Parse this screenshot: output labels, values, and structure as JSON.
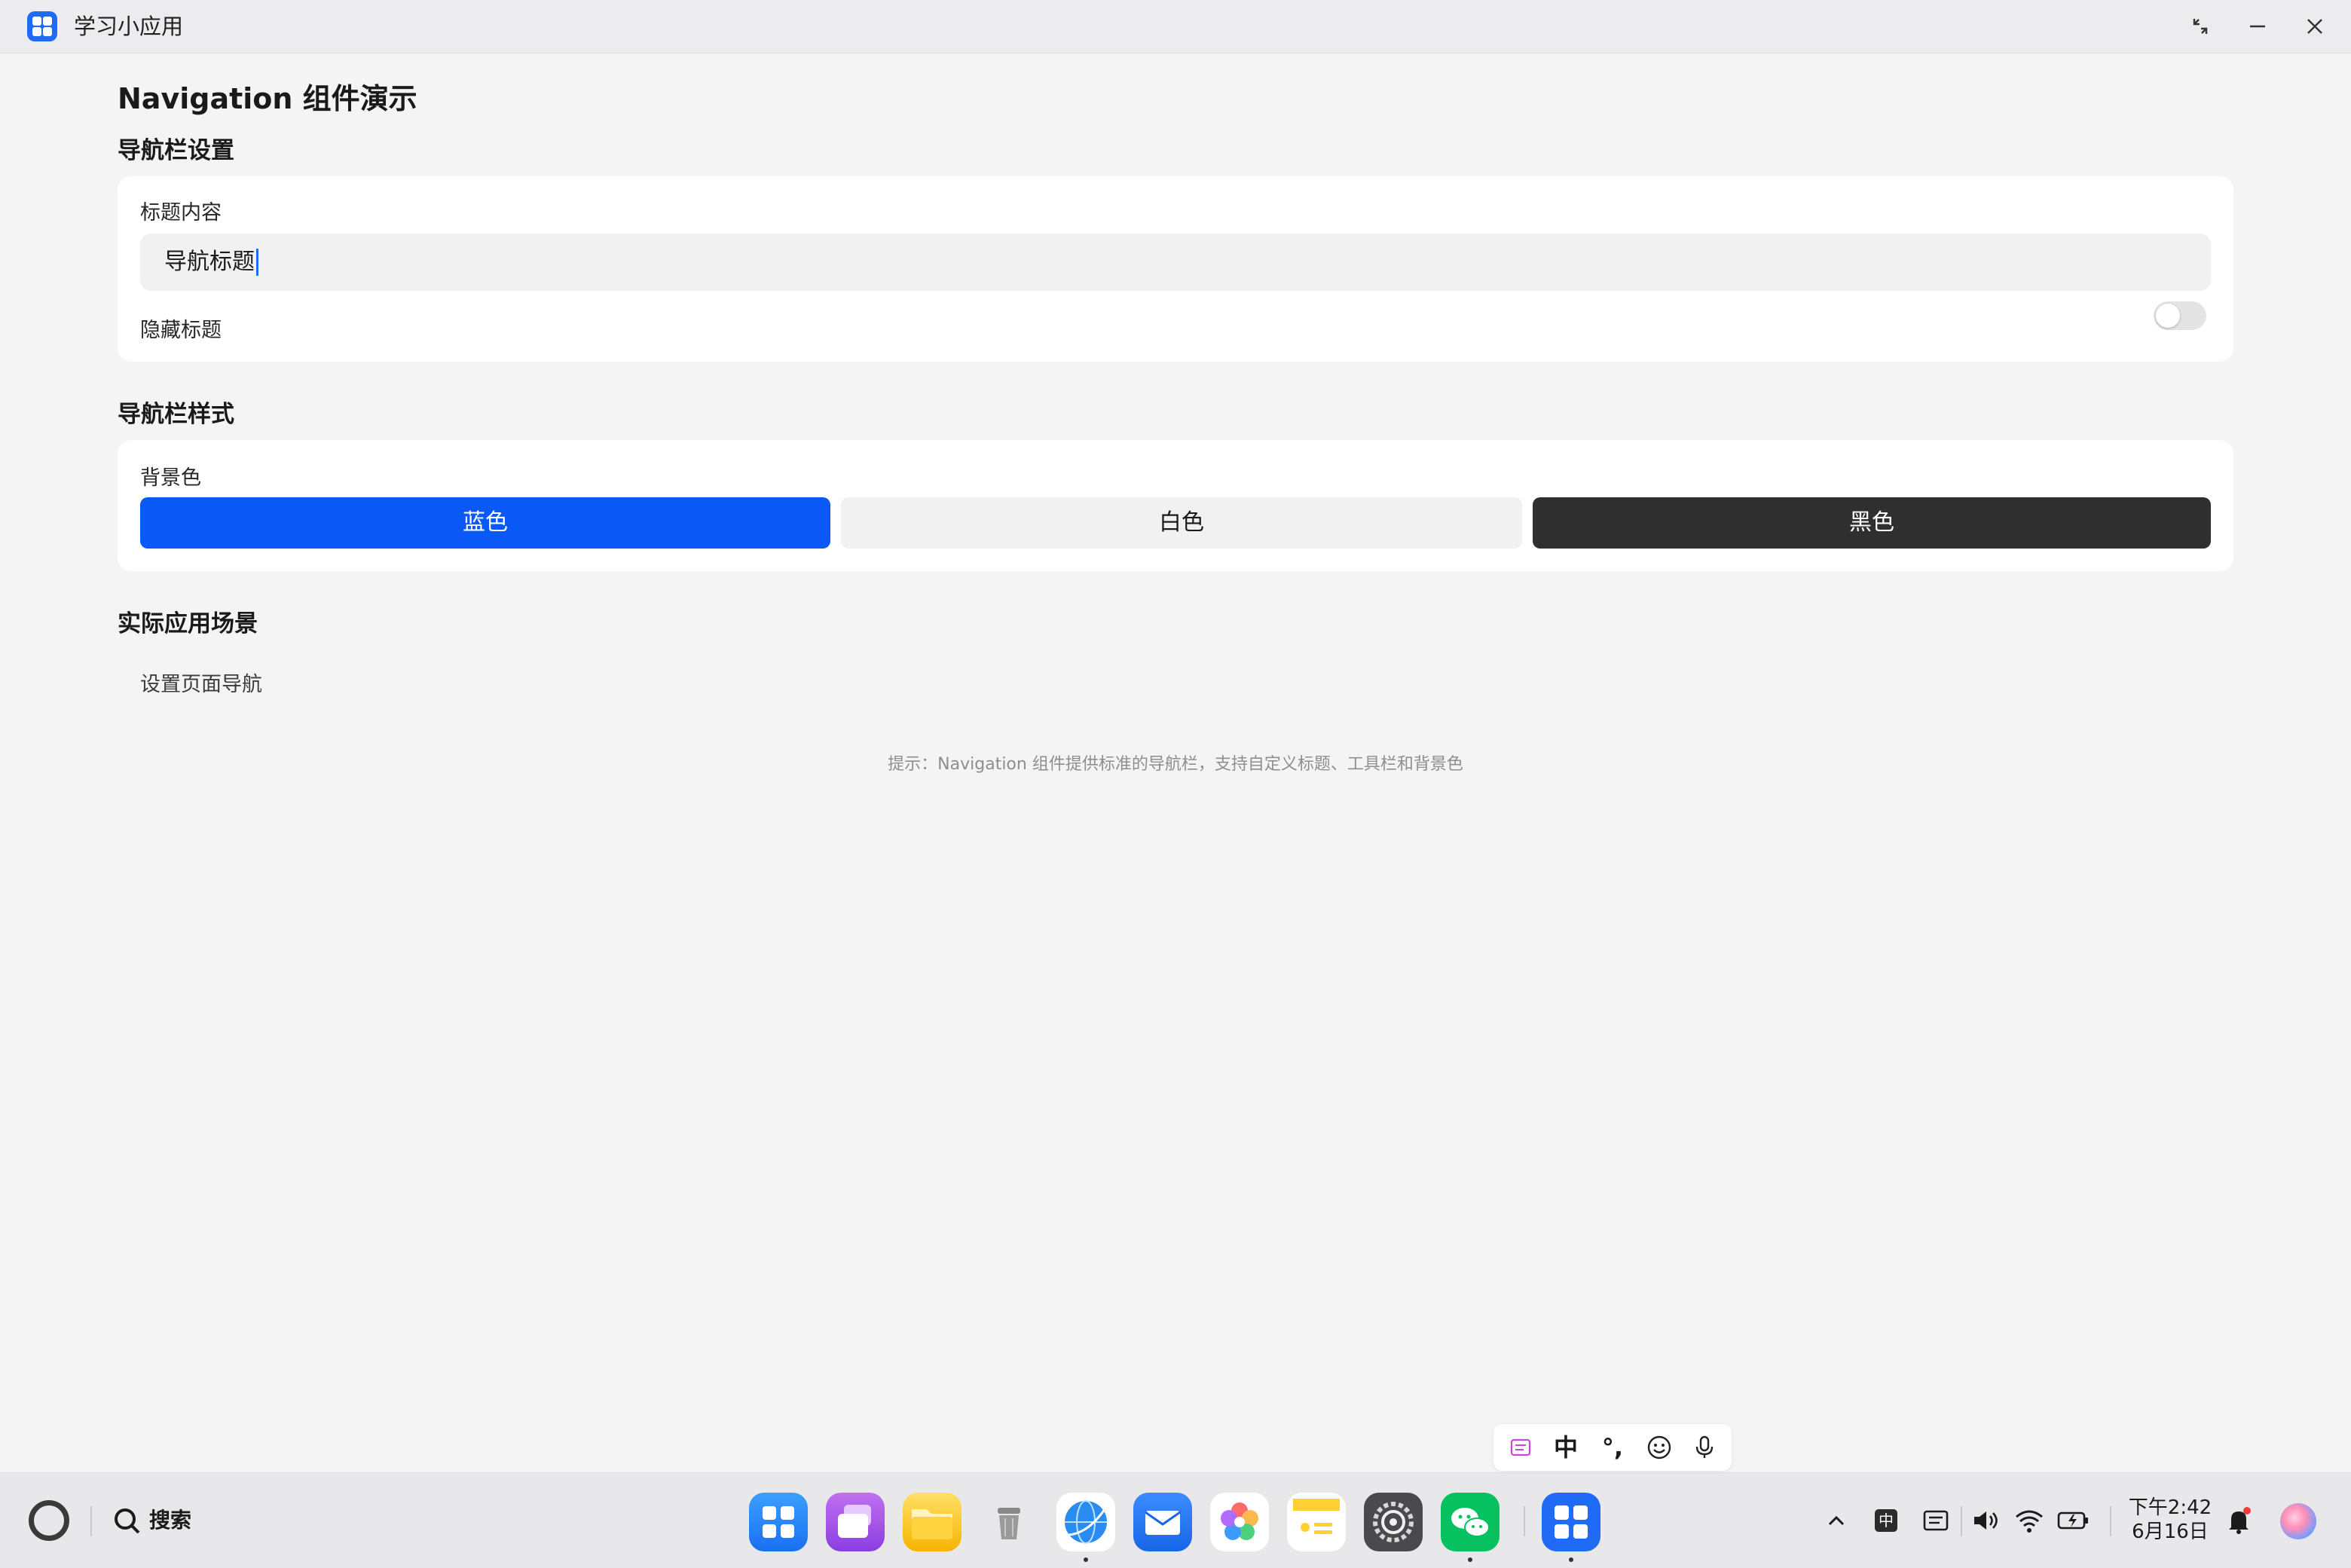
{
  "window": {
    "app_title": "学习小应用"
  },
  "page": {
    "title": "Navigation 组件演示",
    "nav_settings": {
      "section_title": "导航栏设置",
      "title_label": "标题内容",
      "title_value": "导航标题",
      "hide_label": "隐藏标题",
      "hide_checked": false
    },
    "nav_style": {
      "section_title": "导航栏样式",
      "bg_label": "背景色",
      "options": [
        {
          "label": "蓝色",
          "bg": "#0a59f7",
          "fg": "#ffffff"
        },
        {
          "label": "白色",
          "bg": "#f1f1f1",
          "fg": "#1a1a1a"
        },
        {
          "label": "黑色",
          "bg": "#2f2f2f",
          "fg": "#ffffff"
        }
      ]
    },
    "scenes": {
      "section_title": "实际应用场景",
      "item": "设置页面导航"
    },
    "hint": "提示：Navigation 组件提供标准的导航栏，支持自定义标题、工具栏和背景色"
  },
  "ime": {
    "mode": "中",
    "punct": "°,",
    "icons": [
      "clipboard-icon",
      "emoji-icon",
      "microphone-icon"
    ]
  },
  "taskbar": {
    "search_label": "搜索",
    "apps": [
      "app-center",
      "multitask",
      "files",
      "trash",
      "browser",
      "mail",
      "gallery",
      "notes",
      "settings",
      "wechat",
      "study-app"
    ],
    "tray": {
      "ime_indicator": "中"
    },
    "clock": {
      "time": "下午2:42",
      "date": "6月16日"
    }
  },
  "colors": {
    "accent": "#0a59f7",
    "page_bg": "#f4f4f4",
    "card_bg": "#ffffff"
  }
}
